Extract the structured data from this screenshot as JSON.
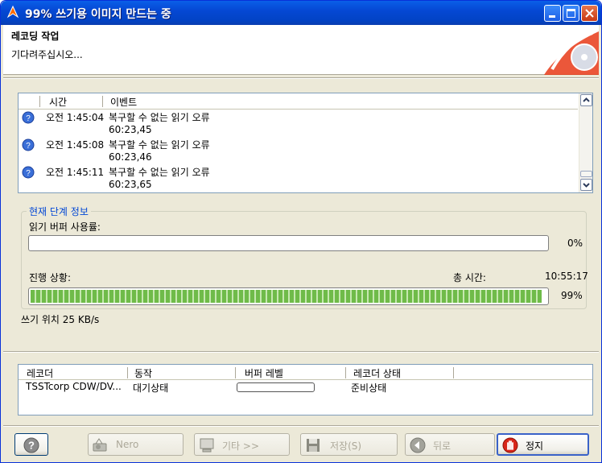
{
  "window": {
    "title": "99% 쓰기용 이미지 만드는 중"
  },
  "header": {
    "title": "레코딩 작업",
    "subtitle": "기다려주십시오..."
  },
  "events": {
    "columns": [
      "시간",
      "이벤트"
    ],
    "rows": [
      {
        "time": "오전 1:45:04",
        "message": "복구할 수 없는 읽기 오류",
        "value": "60:23,45",
        "icon": "info-icon"
      },
      {
        "time": "오전 1:45:08",
        "message": "복구할 수 없는 읽기 오류",
        "value": "60:23,46",
        "icon": "info-icon"
      },
      {
        "time": "오전 1:45:11",
        "message": "복구할 수 없는 읽기 오류",
        "value": "60:23,65",
        "icon": "info-icon"
      }
    ]
  },
  "phase": {
    "legend": "현재 단계 정보",
    "buffer_label": "읽기 버퍼 사용률:",
    "buffer_percent": "0%",
    "buffer_value": 0,
    "progress_label": "진행 상황:",
    "total_time_label": "총 시간:",
    "total_time": "10:55:17",
    "progress_percent": "99%",
    "progress_value": 0.99
  },
  "write_speed": "쓰기 위치 25 KB/s",
  "recorder": {
    "columns": [
      "레코더",
      "동작",
      "버퍼 레벨",
      "레코더 상태"
    ],
    "rows": [
      {
        "name": "TSSTcorp CDW/DV...",
        "action": "대기상태",
        "buffer_level": 0,
        "status": "준비상태"
      }
    ]
  },
  "buttons": {
    "help": "?",
    "nero": "Nero",
    "other": "기타 >>",
    "save": "저장(S)",
    "back": "뒤로",
    "stop": "정지"
  },
  "colors": {
    "titlebar": "#0548d4",
    "progress": "#6fbb49",
    "legend": "#0046d5"
  }
}
